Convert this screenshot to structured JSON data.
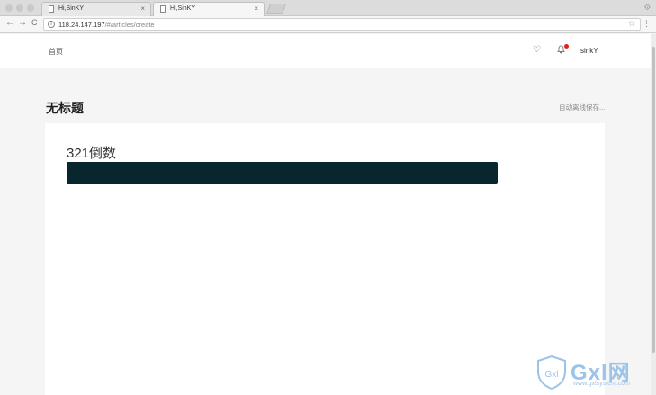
{
  "browser": {
    "tabs": [
      {
        "title": "Hi,SinKY",
        "close": "×"
      },
      {
        "title": "Hi,SinKY",
        "close": "×"
      }
    ],
    "url_host": "118.24.147.197",
    "url_path": "/#/articles/create",
    "nav": {
      "back": "←",
      "forward": "→",
      "reload": "C"
    },
    "star": "☆",
    "menu": "⋮",
    "window_icon": "⟐"
  },
  "header": {
    "home_label": "首页",
    "heart_icon": "♡",
    "bell_icon": "🔔",
    "username": "sinkY",
    "notification_color": "#e02020"
  },
  "page": {
    "title": "无标题",
    "autosave_status": "自动离线保存..."
  },
  "editor": {
    "title_text": "321倒数",
    "bar_color": "#08262e"
  },
  "watermark": {
    "shield_letters": "Gxl",
    "brand": "Gxl网",
    "url": "www.gxlsystem.com"
  }
}
